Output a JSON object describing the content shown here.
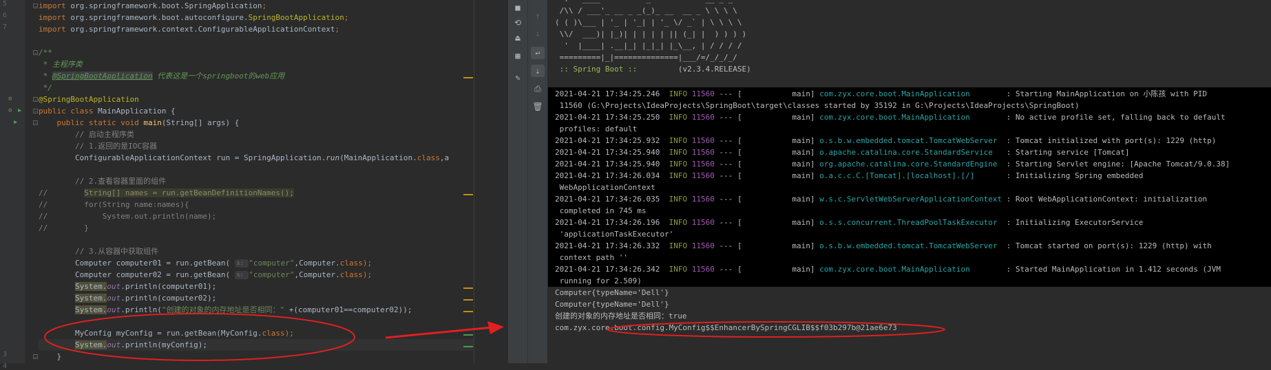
{
  "editor": {
    "lines": [
      [
        {
          "t": "import ",
          "c": "kw"
        },
        {
          "t": "org.springframework.boot.SpringApplication"
        },
        {
          "t": ";",
          "c": "kw"
        }
      ],
      [
        {
          "t": "import ",
          "c": "kw"
        },
        {
          "t": "org.springframework.boot.autoconfigure."
        },
        {
          "t": "SpringBootApplication",
          "c": "ann"
        },
        {
          "t": ";",
          "c": "kw"
        }
      ],
      [
        {
          "t": "import ",
          "c": "kw"
        },
        {
          "t": "org.springframework.context.ConfigurableApplicationContext"
        },
        {
          "t": ";",
          "c": "kw"
        }
      ],
      [],
      [
        {
          "t": "/**",
          "c": "doc"
        }
      ],
      [
        {
          "t": " * 主程序类",
          "c": "doc"
        }
      ],
      [
        {
          "t": " * ",
          "c": "doc"
        },
        {
          "t": "@SpringBootApplication",
          "c": "doctag"
        },
        {
          "t": " 代表这是一个springboot的web应用",
          "c": "doc"
        }
      ],
      [
        {
          "t": " */",
          "c": "doc"
        }
      ],
      [
        {
          "t": "@SpringBootApplication",
          "c": "ann"
        }
      ],
      [
        {
          "t": "public class ",
          "c": "kw"
        },
        {
          "t": "MainApplication {"
        }
      ],
      [
        {
          "t": "    public static void ",
          "c": "kw"
        },
        {
          "t": "main",
          "c": "fn"
        },
        {
          "t": "(String[] args) {"
        }
      ],
      [
        {
          "t": "        // 启动主程序类",
          "c": "cmt"
        }
      ],
      [
        {
          "t": "        // 1.返回的是IOC容器",
          "c": "cmt"
        }
      ],
      [
        {
          "t": "        ConfigurableApplicationContext run = SpringApplication."
        },
        {
          "t": "run",
          "c": "meth"
        },
        {
          "t": "(MainApplication."
        },
        {
          "t": "class",
          "c": "kw"
        },
        {
          "t": ",a"
        }
      ],
      [],
      [
        {
          "t": "        // 2.查看容器里面的组件",
          "c": "cmt"
        }
      ],
      [
        {
          "t": "//        ",
          "c": "cmt"
        },
        {
          "t": "String[] names = run.getBeanDefinitionNames();",
          "c": "hl-dead"
        }
      ],
      [
        {
          "t": "//        for(String name:names){",
          "c": "cmt"
        }
      ],
      [
        {
          "t": "//            System.out.println(name);",
          "c": "cmt"
        }
      ],
      [
        {
          "t": "//        }",
          "c": "cmt"
        }
      ],
      [],
      [
        {
          "t": "        // 3.从容器中获取组件",
          "c": "cmt"
        }
      ],
      [
        {
          "t": "        Computer computer01 = run.getBean( "
        },
        {
          "t": "s: ",
          "c": "hint"
        },
        {
          "t": "\"computer\"",
          "c": "str"
        },
        {
          "t": ",Computer."
        },
        {
          "t": "class",
          "c": "kw"
        },
        {
          "t": ");",
          "c": "kw"
        }
      ],
      [
        {
          "t": "        Computer computer02 = run.getBean( "
        },
        {
          "t": "s: ",
          "c": "hint"
        },
        {
          "t": "\"computer\"",
          "c": "str"
        },
        {
          "t": ",Computer."
        },
        {
          "t": "class",
          "c": "kw"
        },
        {
          "t": ");",
          "c": "kw"
        }
      ],
      [
        {
          "t": "        "
        },
        {
          "t": "System.",
          "c": "hl-warn"
        },
        {
          "t": "out",
          "c": "fld"
        },
        {
          "t": ".println(computer01);"
        }
      ],
      [
        {
          "t": "        "
        },
        {
          "t": "System.",
          "c": "hl-warn"
        },
        {
          "t": "out",
          "c": "fld"
        },
        {
          "t": ".println(computer02);"
        }
      ],
      [
        {
          "t": "        "
        },
        {
          "t": "System.",
          "c": "hl-warn"
        },
        {
          "t": "out",
          "c": "fld"
        },
        {
          "t": ".println("
        },
        {
          "t": "\"创建的对象的内存地址是否相同：\"",
          "c": "str"
        },
        {
          "t": " +(computer01==computer02));"
        }
      ],
      [],
      [
        {
          "t": "        MyConfig myConfig = run.getBean(MyConfig."
        },
        {
          "t": "class",
          "c": "kw"
        },
        {
          "t": ");",
          "c": "kw"
        }
      ],
      [
        {
          "t": "        "
        },
        {
          "t": "System.",
          "c": "hl-warn"
        },
        {
          "t": "out",
          "c": "fld"
        },
        {
          "t": ".println(myConfig);"
        }
      ],
      [
        {
          "t": "    }"
        }
      ]
    ],
    "gutter_numbers": [
      "5",
      "6",
      "7",
      "",
      "",
      "",
      "",
      "",
      "",
      "",
      "",
      "",
      "",
      "",
      "",
      "",
      "",
      "",
      "",
      "",
      "",
      "",
      "",
      "",
      "",
      "",
      "",
      "",
      "",
      "",
      "3",
      "4"
    ]
  },
  "console": {
    "banner": [
      "  .   ____          _            __ _ _",
      " /\\\\ / ___'_ __ _ _(_)_ __  __ _ \\ \\ \\ \\",
      "( ( )\\___ | '_ | '_| | '_ \\/ _` | \\ \\ \\ \\",
      " \\\\/  ___)| |_)| | | | | || (_| |  ) ) ) )",
      "  '  |____| .__|_| |_|_| |_\\__, | / / / /",
      " =========|_|==============|___/=/_/_/_/"
    ],
    "boot_label": " :: Spring Boot :: ",
    "boot_version": "        (v2.3.4.RELEASE)",
    "logs": [
      {
        "time": "2021-04-21 17:34:25.246",
        "level": "  INFO",
        "pid": " 11560",
        "sep": " --- [           main] ",
        "logger": "com.zyx.core.boot.MainApplication       ",
        "msg": " : Starting MainApplication on 小陈孩 with PID",
        "cont": " 11560 (G:\\Projects\\IdeaProjects\\SpringBoot\\target\\classes started by 35192 in G:\\Projects\\IdeaProjects\\SpringBoot)"
      },
      {
        "time": "2021-04-21 17:34:25.250",
        "level": "  INFO",
        "pid": " 11560",
        "sep": " --- [           main] ",
        "logger": "com.zyx.core.boot.MainApplication       ",
        "msg": " : No active profile set, falling back to default",
        "cont": " profiles: default"
      },
      {
        "time": "2021-04-21 17:34:25.932",
        "level": "  INFO",
        "pid": " 11560",
        "sep": " --- [           main] ",
        "logger": "o.s.b.w.embedded.tomcat.TomcatWebServer ",
        "msg": " : Tomcat initialized with port(s): 1229 (http)",
        "cont": ""
      },
      {
        "time": "2021-04-21 17:34:25.940",
        "level": "  INFO",
        "pid": " 11560",
        "sep": " --- [           main] ",
        "logger": "o.apache.catalina.core.StandardService  ",
        "msg": " : Starting service [Tomcat]",
        "cont": ""
      },
      {
        "time": "2021-04-21 17:34:25.940",
        "level": "  INFO",
        "pid": " 11560",
        "sep": " --- [           main] ",
        "logger": "org.apache.catalina.core.StandardEngine ",
        "msg": " : Starting Servlet engine: [Apache Tomcat/9.0.38]",
        "cont": ""
      },
      {
        "time": "2021-04-21 17:34:26.034",
        "level": "  INFO",
        "pid": " 11560",
        "sep": " --- [           main] ",
        "logger": "o.a.c.c.C.[Tomcat].[localhost].[/]      ",
        "msg": " : Initializing Spring embedded",
        "cont": " WebApplicationContext"
      },
      {
        "time": "2021-04-21 17:34:26.035",
        "level": "  INFO",
        "pid": " 11560",
        "sep": " --- [           main] ",
        "logger": "w.s.c.ServletWebServerApplicationContext",
        "msg": " : Root WebApplicationContext: initialization",
        "cont": " completed in 745 ms"
      },
      {
        "time": "2021-04-21 17:34:26.196",
        "level": "  INFO",
        "pid": " 11560",
        "sep": " --- [           main] ",
        "logger": "o.s.s.concurrent.ThreadPoolTaskExecutor ",
        "msg": " : Initializing ExecutorService",
        "cont": " 'applicationTaskExecutor'"
      },
      {
        "time": "2021-04-21 17:34:26.332",
        "level": "  INFO",
        "pid": " 11560",
        "sep": " --- [           main] ",
        "logger": "o.s.b.w.embedded.tomcat.TomcatWebServer ",
        "msg": " : Tomcat started on port(s): 1229 (http) with",
        "cont": " context path ''"
      },
      {
        "time": "2021-04-21 17:34:26.342",
        "level": "  INFO",
        "pid": " 11560",
        "sep": " --- [           main] ",
        "logger": "com.zyx.core.boot.MainApplication       ",
        "msg": " : Started MainApplication in 1.412 seconds (JVM",
        "cont": " running for 2.509)"
      }
    ],
    "output": [
      "Computer{typeName='Dell'}",
      "Computer{typeName='Dell'}",
      "创建的对象的内存地址是否相同：true",
      "com.zyx.core.boot.config.MyConfig$$EnhancerBySpringCGLIB$$f03b297b@21ae6e73"
    ]
  },
  "toolbar": {
    "left": [
      "stop-icon",
      "rerun-icon",
      "exit-icon",
      "layout-icon",
      "pin-icon"
    ],
    "right": [
      "up-arrow-icon",
      "down-arrow-icon",
      "soft-wrap-icon",
      "scroll-to-end-icon",
      "print-icon",
      "trash-icon"
    ]
  },
  "colors": {
    "annotation_red": "#e02020",
    "editor_bg": "#2b2b2b",
    "console_bg": "#000000"
  }
}
